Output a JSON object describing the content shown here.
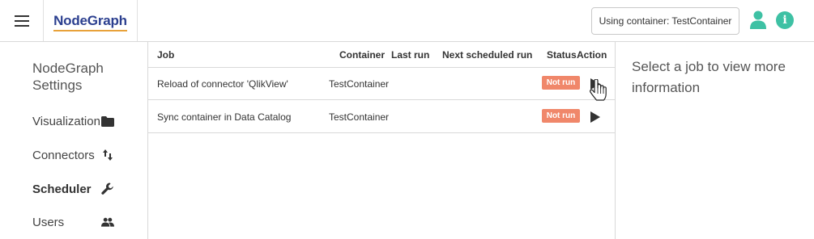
{
  "header": {
    "logo_text": "NodeGraph",
    "container_button_label": "Using container: TestContainer",
    "accent_color": "#3ec1a4",
    "brand_color": "#2b3f8f",
    "icons": [
      "menu-icon",
      "user-icon",
      "info-icon"
    ],
    "info_glyph": "i"
  },
  "sidebar": {
    "title": "NodeGraph Settings",
    "items": [
      {
        "label": "Visualization",
        "icon": "folder-icon",
        "active": false
      },
      {
        "label": "Connectors",
        "icon": "swap-vertical-icon",
        "active": false
      },
      {
        "label": "Scheduler",
        "icon": "wrench-icon",
        "active": true
      },
      {
        "label": "Users",
        "icon": "users-icon",
        "active": false
      }
    ]
  },
  "table": {
    "columns": [
      "Job",
      "Container",
      "Last run",
      "Next scheduled run",
      "Status",
      "Action"
    ],
    "rows": [
      {
        "job": "Reload of connector 'QlikView'",
        "container": "TestContainer",
        "last_run": "",
        "next_run": "",
        "status": "Not run",
        "action_icon": "play-icon"
      },
      {
        "job": "Sync container in Data Catalog",
        "container": "TestContainer",
        "last_run": "",
        "next_run": "",
        "status": "Not run",
        "action_icon": "play-icon"
      }
    ],
    "status_color": "#f0876a"
  },
  "info_panel": {
    "message": "Select a job to view more information"
  }
}
